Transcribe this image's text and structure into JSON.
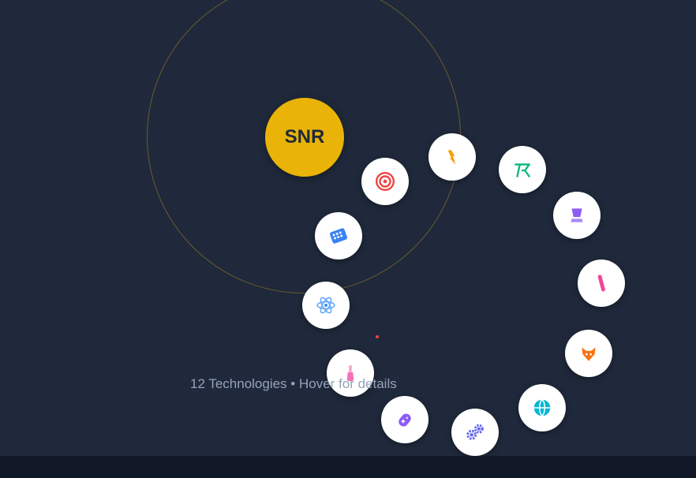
{
  "center": {
    "label": "SNR",
    "color": "#e9b308"
  },
  "caption": "12 Technologies • Hover for details",
  "technologies": [
    {
      "icon": "target-icon",
      "color": "#ef4444"
    },
    {
      "icon": "lightning-icon",
      "color": "#f59e0b"
    },
    {
      "icon": "route-icon",
      "color": "#10b981"
    },
    {
      "icon": "cup-icon",
      "color": "#8b5cf6"
    },
    {
      "icon": "stick-icon",
      "color": "#ec4899"
    },
    {
      "icon": "fox-icon",
      "color": "#f97316"
    },
    {
      "icon": "globe-icon",
      "color": "#06b6d4"
    },
    {
      "icon": "gears-icon",
      "color": "#6366f1"
    },
    {
      "icon": "gamepad-icon",
      "color": "#8b5cf6"
    },
    {
      "icon": "brush-icon",
      "color": "#f472b6"
    },
    {
      "icon": "atom-icon",
      "color": "#3b82f6"
    },
    {
      "icon": "keypad-icon",
      "color": "#3b82f6"
    }
  ]
}
